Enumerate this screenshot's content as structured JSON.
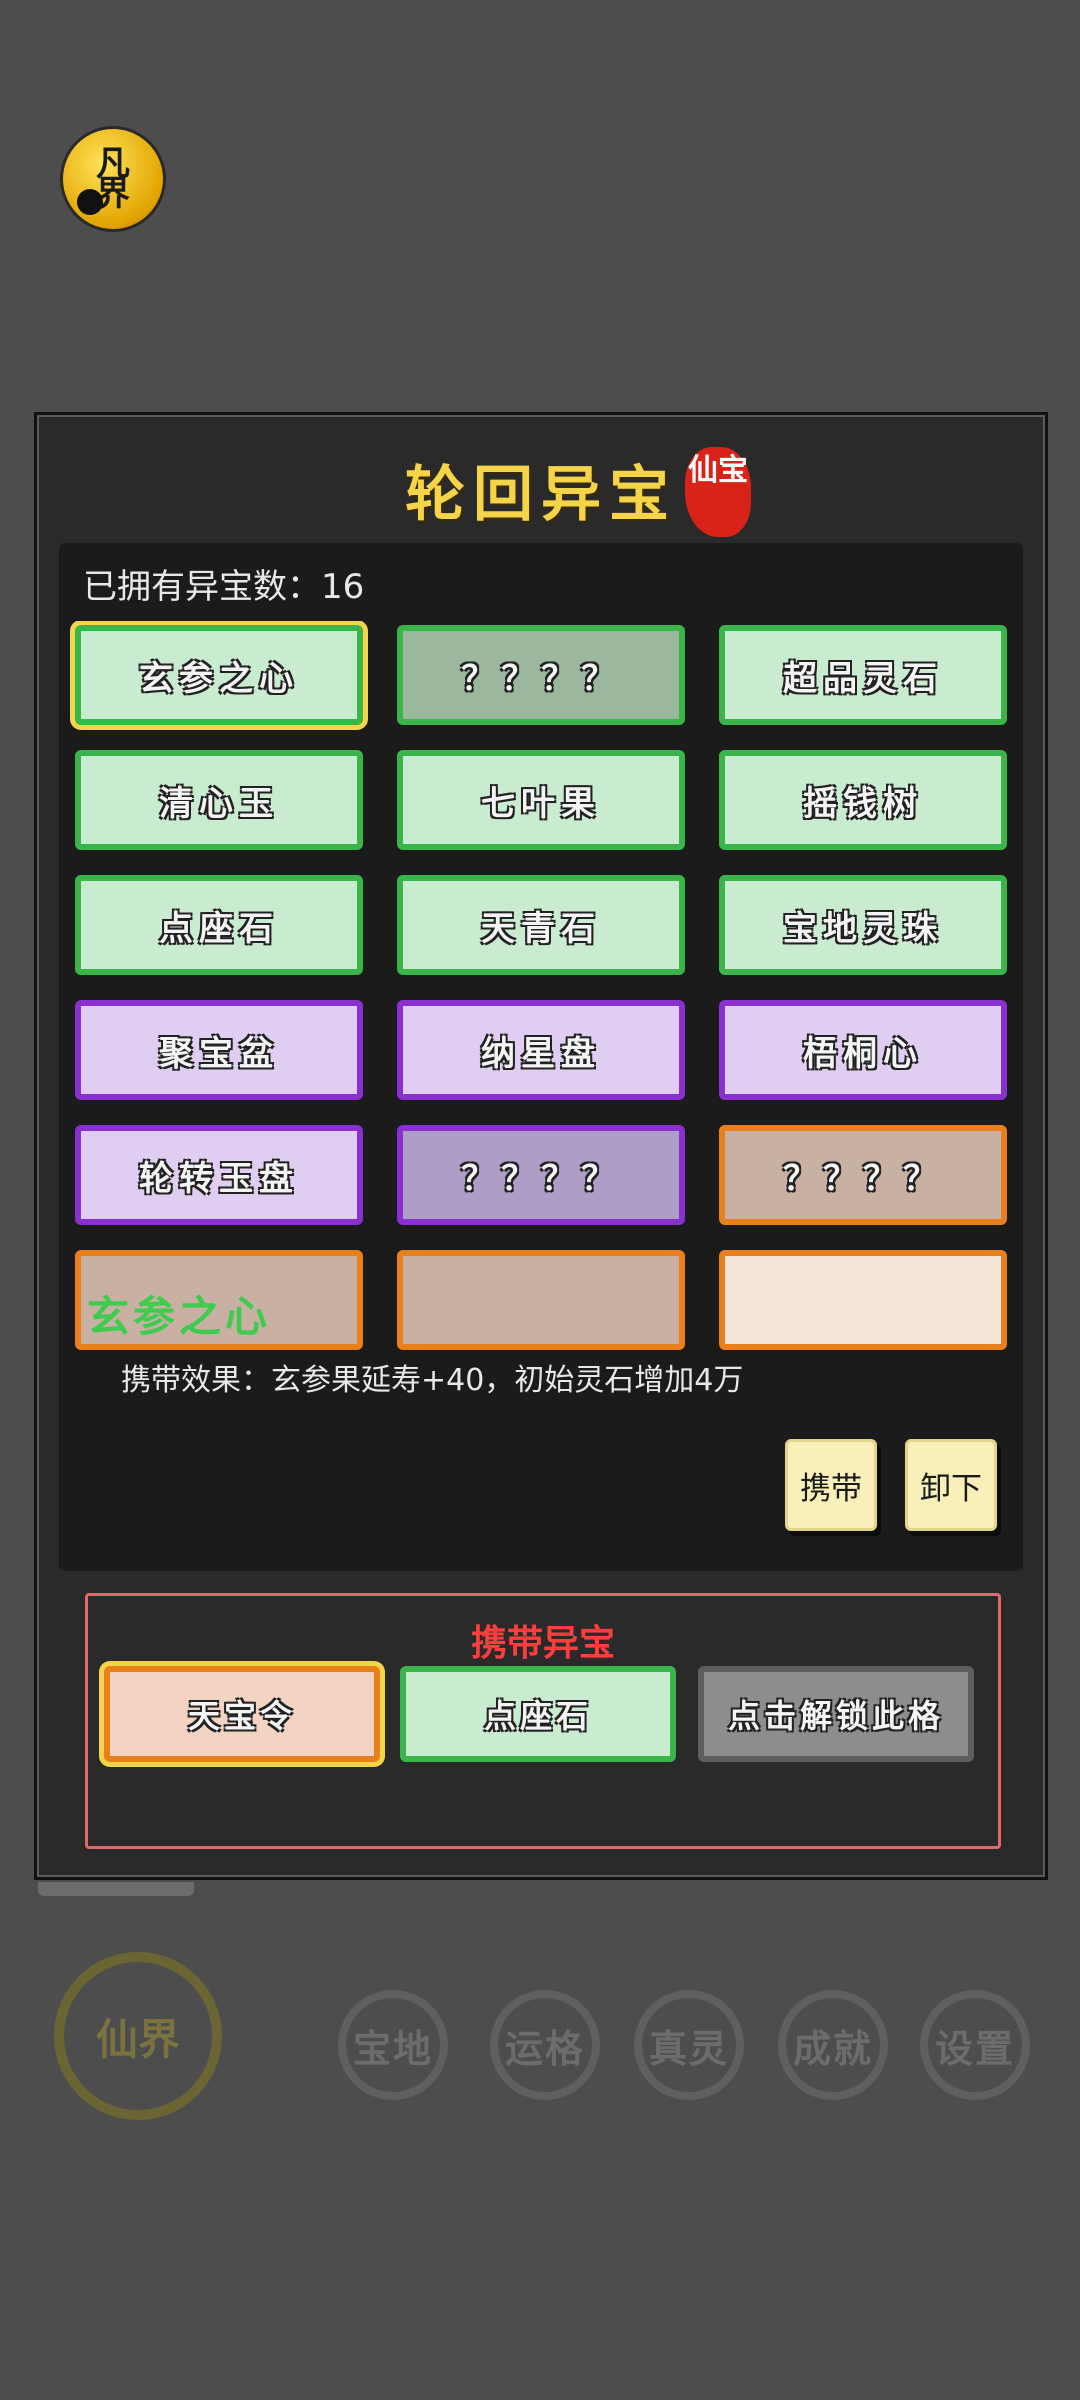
{
  "app": {
    "badge_text": "凡界"
  },
  "panel": {
    "title": "轮回异宝",
    "seal_text": "仙宝",
    "owned_label": "已拥有异宝数：16"
  },
  "treasures": [
    {
      "name": "玄参之心",
      "rarity": "green",
      "selected": true
    },
    {
      "name": "？？？？",
      "rarity": "green-locked"
    },
    {
      "name": "超品灵石",
      "rarity": "green"
    },
    {
      "name": "清心玉",
      "rarity": "green"
    },
    {
      "name": "七叶果",
      "rarity": "green"
    },
    {
      "name": "摇钱树",
      "rarity": "green"
    },
    {
      "name": "点座石",
      "rarity": "green"
    },
    {
      "name": "天青石",
      "rarity": "green"
    },
    {
      "name": "宝地灵珠",
      "rarity": "green"
    },
    {
      "name": "聚宝盆",
      "rarity": "purple"
    },
    {
      "name": "纳星盘",
      "rarity": "purple"
    },
    {
      "name": "梧桐心",
      "rarity": "purple"
    },
    {
      "name": "轮转玉盘",
      "rarity": "purple"
    },
    {
      "name": "？？？？",
      "rarity": "purple-locked"
    },
    {
      "name": "？？？？",
      "rarity": "orange-locked"
    },
    {
      "name": "",
      "rarity": "orange-locked"
    },
    {
      "name": "",
      "rarity": "orange-locked"
    },
    {
      "name": "",
      "rarity": "orange"
    }
  ],
  "detail": {
    "name": "玄参之心",
    "effect": "携带效果：玄参果延寿+40，初始灵石增加4万",
    "carry_button": "携带",
    "unload_button": "卸下"
  },
  "carry": {
    "title": "携带异宝",
    "slots": [
      {
        "name": "天宝令",
        "state": "orange-selected"
      },
      {
        "name": "点座石",
        "state": "green"
      },
      {
        "name": "点击解锁此格",
        "state": "locked"
      }
    ]
  },
  "nav": {
    "main": "仙界",
    "items": [
      "宝地",
      "运格",
      "真灵",
      "成就",
      "设置"
    ]
  },
  "colors": {
    "green_border": "#3ab54a",
    "purple_border": "#8a2fd0",
    "orange_border": "#e9801c",
    "title_gold": "#f5d44a",
    "carry_red": "#ff3d3d"
  }
}
